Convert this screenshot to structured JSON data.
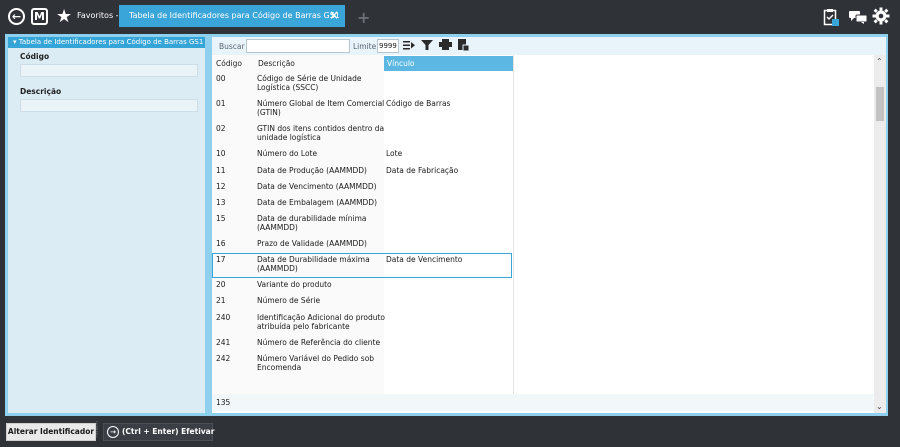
{
  "topbar": {
    "back_icon": "back-arrow-icon",
    "m_logo": "M",
    "favorites_label": "Favoritos -",
    "tab_label": "Tabela de Identificadores para Código de Barras GS1",
    "tab_close": "×",
    "new_tab": "+",
    "right_icons": [
      "clipboard-icon",
      "chat-icon",
      "gear-icon"
    ]
  },
  "sidebar": {
    "header": "Tabela de Identificadores para Código de Barras GS1",
    "fields": [
      {
        "label": "Código",
        "value": ""
      },
      {
        "label": "Descrição",
        "value": ""
      }
    ]
  },
  "toolbar": {
    "search_label": "Buscar",
    "search_value": "",
    "limit_label": "Limite",
    "limit_value": "9999"
  },
  "grid": {
    "columns": [
      "Código",
      "Descrição",
      "Vínculo"
    ],
    "rows": [
      {
        "codigo": "00",
        "descricao": "Código de Série de Unidade Logística (SSCC)",
        "vinculo": ""
      },
      {
        "codigo": "01",
        "descricao": "Número Global de Item Comercial (GTIN)",
        "vinculo": "Código de Barras"
      },
      {
        "codigo": "02",
        "descricao": "GTIN dos itens contidos dentro da unidade logística",
        "vinculo": ""
      },
      {
        "codigo": "10",
        "descricao": "Número do Lote",
        "vinculo": "Lote"
      },
      {
        "codigo": "11",
        "descricao": "Data de Produção (AAMMDD)",
        "vinculo": "Data de Fabricação"
      },
      {
        "codigo": "12",
        "descricao": "Data de Vencimento (AAMMDD)",
        "vinculo": ""
      },
      {
        "codigo": "13",
        "descricao": "Data de Embalagem (AAMMDD)",
        "vinculo": ""
      },
      {
        "codigo": "15",
        "descricao": "Data de durabilidade mínima (AAMMDD)",
        "vinculo": ""
      },
      {
        "codigo": "16",
        "descricao": "Prazo de Validade (AAMMDD)",
        "vinculo": ""
      },
      {
        "codigo": "17",
        "descricao": "Data de Durabilidade máxima (AAMMDD)",
        "vinculo": "Data de Vencimento"
      },
      {
        "codigo": "20",
        "descricao": "Variante do produto",
        "vinculo": ""
      },
      {
        "codigo": "21",
        "descricao": "Número de Série",
        "vinculo": ""
      },
      {
        "codigo": "240",
        "descricao": "Identificação Adicional do produto atribuída pelo fabricante",
        "vinculo": ""
      },
      {
        "codigo": "241",
        "descricao": "Número de Referência do cliente",
        "vinculo": ""
      },
      {
        "codigo": "242",
        "descricao": "Número Variável do Pedido sob Encomenda",
        "vinculo": ""
      }
    ],
    "selected_row": 9,
    "record_count": "135"
  },
  "bottombar": {
    "alter_label": "Alterar Identificador",
    "confirm_label": "(Ctrl + Enter) Efetivar"
  },
  "colors": {
    "accent": "#3aa5d9",
    "frame": "#8fd0ef",
    "panel": "#dcecf5",
    "dark": "#2f3237"
  }
}
